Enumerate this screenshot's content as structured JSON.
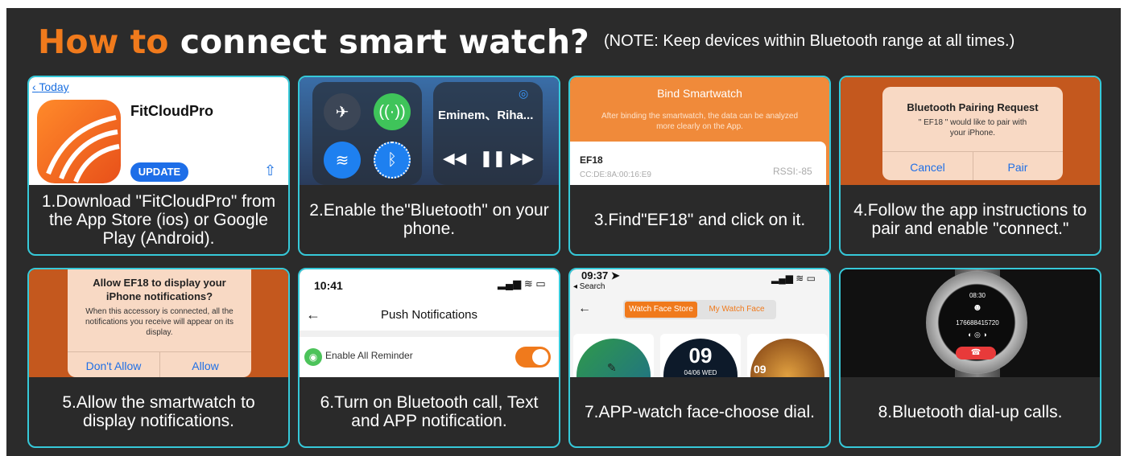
{
  "title": {
    "part1": "How to",
    "part2": "connect smart watch?"
  },
  "note": "(NOTE: Keep devices within Bluetooth range at all times.)",
  "colors": {
    "accent": "#f07a1c",
    "frame": "#2b2b2b",
    "border": "#36c9d9",
    "ios_blue": "#1d6ee8"
  },
  "steps": [
    {
      "caption": "1.Download \"FitCloudPro\" from the App Store (ios) or Google Play (Android).",
      "back": "Today",
      "app_name": "FitCloudPro",
      "update": "UPDATE",
      "share_icon": "share-icon"
    },
    {
      "caption": "2.Enable the\"Bluetooth\" on your phone.",
      "song": "Eminem、Riha...",
      "icons": [
        "airplane-icon",
        "cellular-icon",
        "wifi-icon",
        "bluetooth-icon",
        "airplay-icon",
        "rewind-icon",
        "pause-icon",
        "forward-icon"
      ]
    },
    {
      "caption": "3.Find\"EF18\" and click on it.",
      "header": "Bind Smartwatch",
      "desc": "After binding the smartwatch, the data can be analyzed more clearly on the App.",
      "device": "EF18",
      "mac": "CC:DE:8A:00:16:E9",
      "rssi": "RSSI:-85"
    },
    {
      "caption": "4.Follow the app instructions to pair and enable \"connect.\"",
      "dialog_title": "Bluetooth Pairing Request",
      "dialog_body": "\" EF18 \" would like to pair with your iPhone.",
      "cancel": "Cancel",
      "pair": "Pair"
    },
    {
      "caption": "5.Allow the smartwatch to display notifications.",
      "dialog_title": "Allow EF18 to display your iPhone notifications?",
      "dialog_body": "When this accessory is connected, all the notifications you receive will appear on its display.",
      "deny": "Don't Allow",
      "allow": "Allow"
    },
    {
      "caption": "6.Turn on Bluetooth call, Text and APP notification.",
      "time": "10:41",
      "header": "Push Notifications",
      "reminder": "Enable All Reminder",
      "toggle_on": true
    },
    {
      "caption": "7.APP-watch face-choose dial.",
      "time": "09:37",
      "search": "◂ Search",
      "tab1": "Watch Face Store",
      "tab2": "My Watch Face",
      "face_time": "09",
      "face_date": "04/06 WED",
      "face3_time": "09"
    },
    {
      "caption": "8.Bluetooth dial-up calls.",
      "watch_time": "08:30",
      "watch_number": "176688415720"
    }
  ]
}
